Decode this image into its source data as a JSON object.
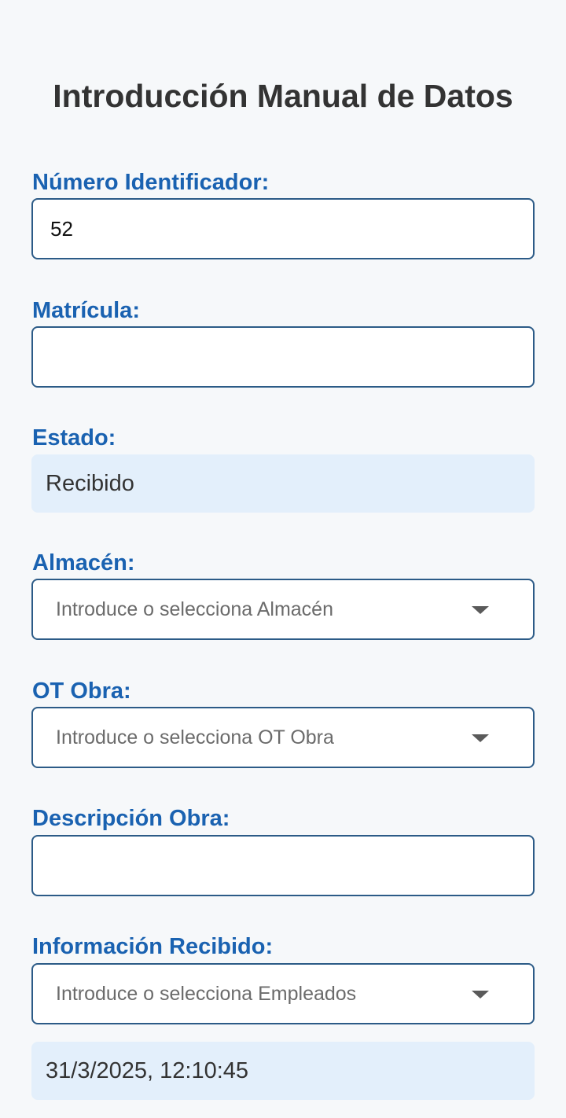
{
  "page": {
    "title": "Introducción Manual de Datos"
  },
  "form": {
    "numero_identificador": {
      "label": "Número Identificador:",
      "value": "52"
    },
    "matricula": {
      "label": "Matrícula:",
      "value": ""
    },
    "estado": {
      "label": "Estado:",
      "value": "Recibido"
    },
    "almacen": {
      "label": "Almacén:",
      "placeholder": "Introduce o selecciona Almacén"
    },
    "ot_obra": {
      "label": "OT Obra:",
      "placeholder": "Introduce o selecciona OT Obra"
    },
    "descripcion_obra": {
      "label": "Descripción Obra:",
      "value": ""
    },
    "informacion_recibido": {
      "label": "Información Recibido:",
      "placeholder": "Introduce o selecciona Empleados",
      "timestamp": "31/3/2025, 12:10:45"
    }
  },
  "colors": {
    "label": "#1a62b1",
    "border": "#2c5b87",
    "readonly_background": "#e3effb",
    "page_background": "#f6f8fa"
  },
  "icons": {
    "dropdown": "caret-down-icon"
  }
}
